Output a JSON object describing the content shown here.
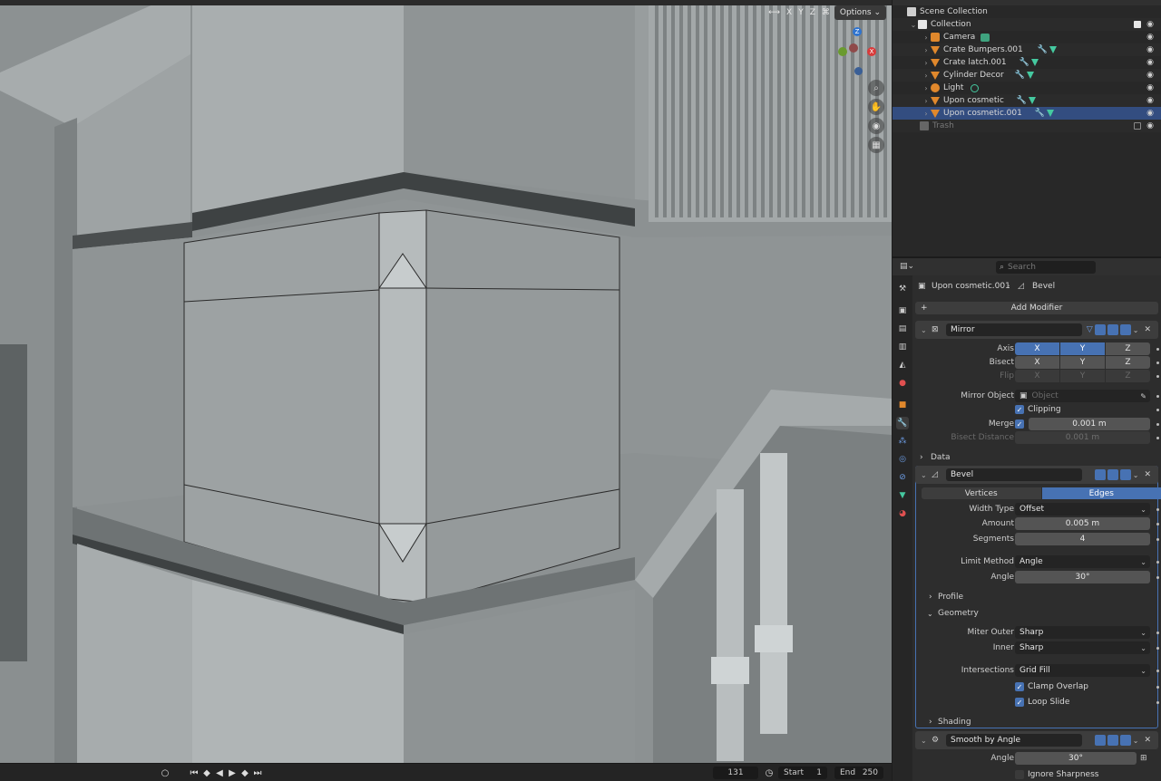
{
  "viewport": {
    "header_axes": [
      "X",
      "Y",
      "Z"
    ],
    "options_label": "Options",
    "gizmo_axes": {
      "z": "Z",
      "y": "Y",
      "x": "X"
    }
  },
  "timeline": {
    "current_frame": "131",
    "start_label": "Start",
    "start_value": "1",
    "end_label": "End",
    "end_value": "250"
  },
  "outliner": {
    "scene_collection": "Scene Collection",
    "collection": "Collection",
    "items": [
      {
        "label": "Camera",
        "type": "camera"
      },
      {
        "label": "Crate Bumpers.001",
        "type": "mesh"
      },
      {
        "label": "Crate latch.001",
        "type": "mesh"
      },
      {
        "label": "Cylinder Decor",
        "type": "mesh"
      },
      {
        "label": "Light",
        "type": "light"
      },
      {
        "label": "Upon cosmetic",
        "type": "mesh"
      },
      {
        "label": "Upon cosmetic.001",
        "type": "mesh"
      }
    ],
    "trash": "Trash"
  },
  "properties": {
    "search_placeholder": "Search",
    "breadcrumb_object": "Upon cosmetic.001",
    "breadcrumb_modifier": "Bevel",
    "add_modifier": "Add Modifier",
    "mirror": {
      "name": "Mirror",
      "axis_label": "Axis",
      "bisect_label": "Bisect",
      "flip_label": "Flip",
      "axes": [
        "X",
        "Y",
        "Z"
      ],
      "mirror_object_label": "Mirror Object",
      "mirror_object_placeholder": "Object",
      "clipping_label": "Clipping",
      "merge_label": "Merge",
      "merge_value": "0.001 m",
      "bisect_distance_label": "Bisect Distance",
      "bisect_distance_value": "0.001 m",
      "data_label": "Data"
    },
    "bevel": {
      "name": "Bevel",
      "tab_vertices": "Vertices",
      "tab_edges": "Edges",
      "width_type_label": "Width Type",
      "width_type_value": "Offset",
      "amount_label": "Amount",
      "amount_value": "0.005 m",
      "segments_label": "Segments",
      "segments_value": "4",
      "limit_method_label": "Limit Method",
      "limit_method_value": "Angle",
      "angle_label": "Angle",
      "angle_value": "30°",
      "profile_label": "Profile",
      "geometry_label": "Geometry",
      "miter_outer_label": "Miter Outer",
      "miter_outer_value": "Sharp",
      "inner_label": "Inner",
      "inner_value": "Sharp",
      "intersections_label": "Intersections",
      "intersections_value": "Grid Fill",
      "clamp_overlap_label": "Clamp Overlap",
      "loop_slide_label": "Loop Slide",
      "shading_label": "Shading"
    },
    "smooth": {
      "name": "Smooth by Angle",
      "angle_label": "Angle",
      "angle_value": "30°",
      "ignore_sharpness_label": "Ignore Sharpness"
    }
  }
}
